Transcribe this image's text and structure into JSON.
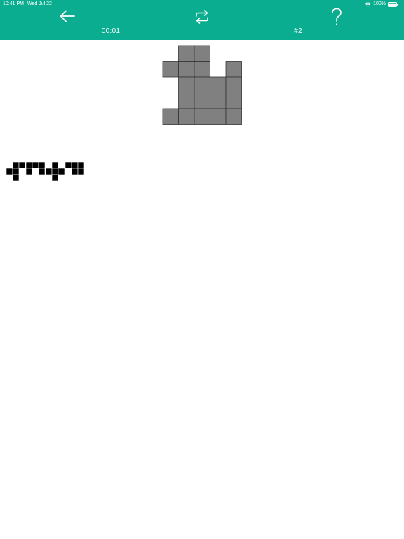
{
  "status_bar": {
    "time": "10:41 PM",
    "date": "Wed Jul 22",
    "battery": "100%",
    "icons": [
      "wifi-icon",
      "battery-icon"
    ]
  },
  "toolbar": {
    "back_icon": "arrow-left-icon",
    "restart_icon": "repeat-icon",
    "help_icon": "question-mark-icon",
    "timer": "00:01",
    "level": "#2"
  },
  "colors": {
    "accent": "#0aad8f",
    "board_cell": "#808080",
    "piece": "#000000"
  },
  "board": {
    "rows": 5,
    "cols": 5,
    "filled": [
      [
        0,
        1
      ],
      [
        0,
        2
      ],
      [
        1,
        0
      ],
      [
        1,
        1
      ],
      [
        1,
        2
      ],
      [
        1,
        4
      ],
      [
        2,
        1
      ],
      [
        2,
        2
      ],
      [
        2,
        3
      ],
      [
        2,
        4
      ],
      [
        3,
        1
      ],
      [
        3,
        2
      ],
      [
        3,
        3
      ],
      [
        3,
        4
      ],
      [
        4,
        0
      ],
      [
        4,
        1
      ],
      [
        4,
        2
      ],
      [
        4,
        3
      ],
      [
        4,
        4
      ]
    ]
  },
  "pieces": [
    {
      "cells": [
        [
          0,
          1
        ],
        [
          0,
          2
        ],
        [
          1,
          0
        ],
        [
          1,
          1
        ],
        [
          2,
          1
        ]
      ]
    },
    {
      "cells": [
        [
          0,
          0
        ],
        [
          0,
          1
        ],
        [
          0,
          2
        ],
        [
          1,
          0
        ],
        [
          1,
          2
        ]
      ]
    },
    {
      "cells": [
        [
          0,
          1
        ],
        [
          1,
          0
        ],
        [
          1,
          1
        ],
        [
          1,
          2
        ],
        [
          2,
          1
        ]
      ]
    },
    {
      "cells": [
        [
          0,
          0
        ],
        [
          0,
          1
        ],
        [
          0,
          2
        ],
        [
          1,
          1
        ],
        [
          1,
          2
        ]
      ]
    }
  ]
}
